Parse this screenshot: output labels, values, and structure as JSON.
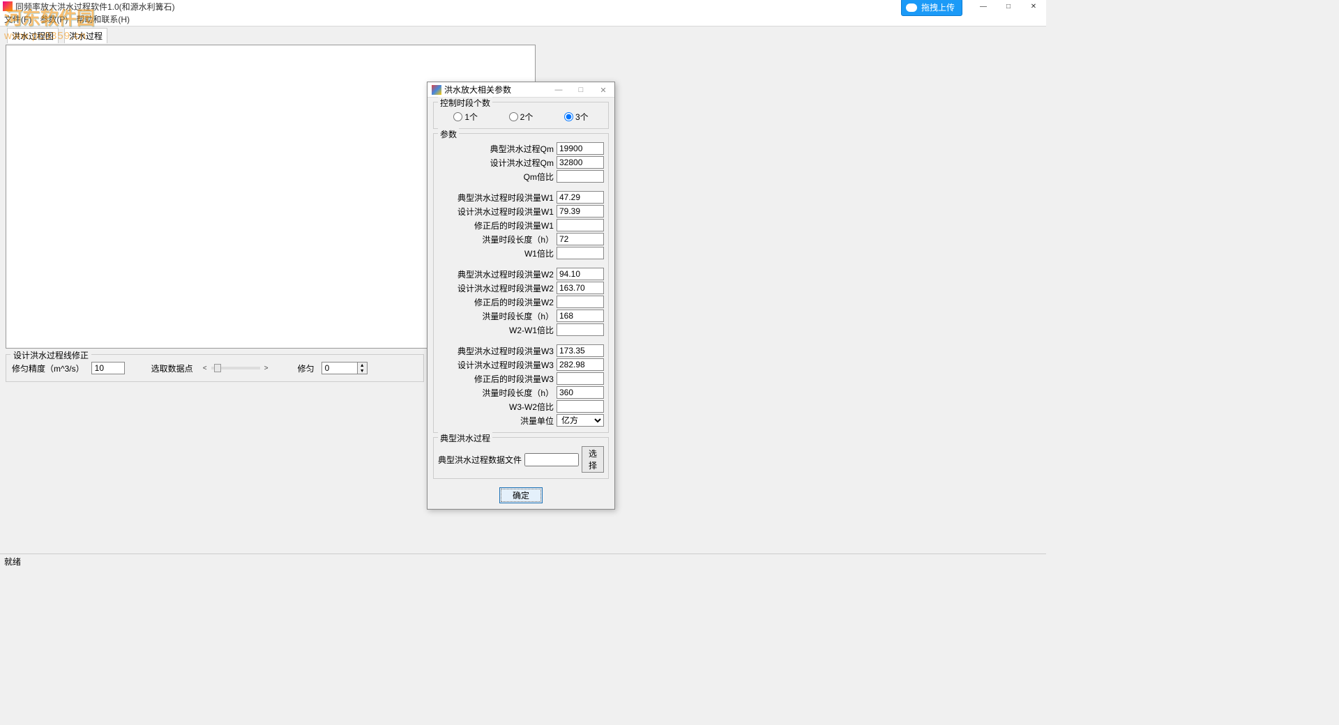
{
  "window": {
    "title": "同频率放大洪水过程软件1.0(和源水利篝石)",
    "upload_badge": "拖拽上传",
    "minimize": "—",
    "maximize": "□",
    "close": "✕"
  },
  "menu": {
    "file": "文件(F)",
    "params": "参数(P)",
    "help": "帮助和联系(H)"
  },
  "watermark": {
    "line1": "河东软件园",
    "line2": "www.pc0359.cn"
  },
  "tabs": {
    "tab1": "洪水过程图",
    "tab2": "洪水过程"
  },
  "correction": {
    "legend": "设计洪水过程线修正",
    "precision_label": "修匀精度（m^3/s）",
    "precision_value": "10",
    "pick_label": "选取数据点",
    "left": "<",
    "right": ">",
    "smooth_label": "修匀",
    "smooth_value": "0"
  },
  "statusbar": {
    "text": "就绪"
  },
  "dialog": {
    "title": "洪水放大相关参数",
    "minimize": "—",
    "maximize": "□",
    "close": "✕",
    "group_segments": {
      "legend": "控制时段个数",
      "opt1": "1个",
      "opt2": "2个",
      "opt3": "3个"
    },
    "group_params": {
      "legend": "参数",
      "rows": [
        {
          "label": "典型洪水过程Qm",
          "value": "19900"
        },
        {
          "label": "设计洪水过程Qm",
          "value": "32800"
        },
        {
          "label": "Qm倍比",
          "value": ""
        },
        {
          "label": "典型洪水过程时段洪量W1",
          "value": "47.29"
        },
        {
          "label": "设计洪水过程时段洪量W1",
          "value": "79.39"
        },
        {
          "label": "修正后的时段洪量W1",
          "value": ""
        },
        {
          "label": "洪量时段长度（h）",
          "value": "72"
        },
        {
          "label": "W1倍比",
          "value": ""
        },
        {
          "label": "典型洪水过程时段洪量W2",
          "value": "94.10"
        },
        {
          "label": "设计洪水过程时段洪量W2",
          "value": "163.70"
        },
        {
          "label": "修正后的时段洪量W2",
          "value": ""
        },
        {
          "label": "洪量时段长度（h）",
          "value": "168"
        },
        {
          "label": "W2-W1倍比",
          "value": ""
        },
        {
          "label": "典型洪水过程时段洪量W3",
          "value": "173.35"
        },
        {
          "label": "设计洪水过程时段洪量W3",
          "value": "282.98"
        },
        {
          "label": "修正后的时段洪量W3",
          "value": ""
        },
        {
          "label": "洪量时段长度（h）",
          "value": "360"
        },
        {
          "label": "W3-W2倍比",
          "value": ""
        }
      ],
      "unit_label": "洪量单位",
      "unit_value": "亿方"
    },
    "group_typical": {
      "legend": "典型洪水过程",
      "file_label": "典型洪水过程数据文件",
      "file_value": "",
      "browse": "选择"
    },
    "ok": "确定"
  }
}
